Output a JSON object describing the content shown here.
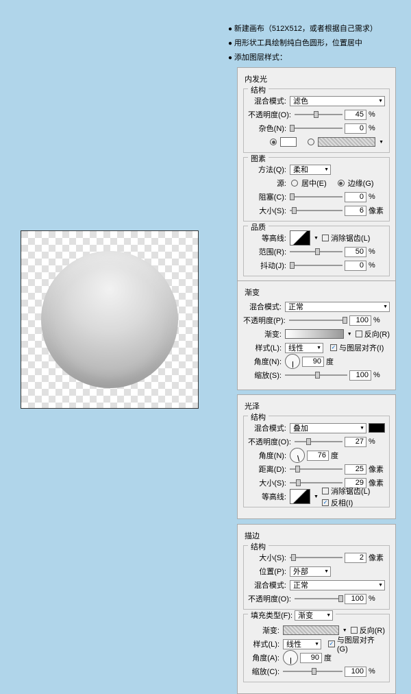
{
  "notes": {
    "l1": "新建画布（512X512，或者根据自己需求）",
    "l2": "用形状工具绘制纯白色圆形，位置居中",
    "l3": "添加图层样式："
  },
  "p1": {
    "title": "内发光",
    "g1": "结构",
    "g2": "图素",
    "g3": "品质",
    "blend_l": "混合模式:",
    "blend_v": "滤色",
    "opac_l": "不透明度(O):",
    "opac_v": "45",
    "pct": "%",
    "noise_l": "杂色(N):",
    "noise_v": "0",
    "method_l": "方法(Q):",
    "method_v": "柔和",
    "source_l": "源:",
    "src_c": "居中(E)",
    "src_e": "边缘(G)",
    "choke_l": "阻塞(C):",
    "choke_v": "0",
    "size_l": "大小(S):",
    "size_v": "6",
    "px": "像素",
    "contour_l": "等高线:",
    "aa": "消除锯齿(L)",
    "range_l": "范围(R):",
    "range_v": "50",
    "jit_l": "抖动(J):",
    "jit_v": "0"
  },
  "p2": {
    "title": "渐变",
    "blend_l": "混合模式:",
    "blend_v": "正常",
    "opac_l": "不透明度(P):",
    "opac_v": "100",
    "pct": "%",
    "grad_l": "渐变:",
    "rev": "反向(R)",
    "style_l": "样式(L):",
    "style_v": "线性",
    "align": "与图层对齐(I)",
    "ang_l": "角度(N):",
    "ang_v": "90",
    "deg": "度",
    "scale_l": "缩放(S):",
    "scale_v": "100"
  },
  "p3": {
    "title": "光泽",
    "g1": "结构",
    "blend_l": "混合模式:",
    "blend_v": "叠加",
    "opac_l": "不透明度(O):",
    "opac_v": "27",
    "pct": "%",
    "ang_l": "角度(N):",
    "ang_v": "76",
    "deg": "度",
    "dist_l": "距离(D):",
    "dist_v": "25",
    "px": "像素",
    "size_l": "大小(S):",
    "size_v": "29",
    "contour_l": "等高线:",
    "aa": "消除锯齿(L)",
    "inv": "反相(I)"
  },
  "p4": {
    "title": "描边",
    "g1": "结构",
    "g2": "填充类型(F):",
    "g2v": "渐变",
    "size_l": "大小(S):",
    "size_v": "2",
    "px": "像素",
    "pos_l": "位置(P):",
    "pos_v": "外部",
    "blend_l": "混合模式:",
    "blend_v": "正常",
    "opac_l": "不透明度(O):",
    "opac_v": "100",
    "pct": "%",
    "grad_l": "渐变:",
    "rev": "反向(R)",
    "style_l": "样式(L):",
    "style_v": "线性",
    "align": "与图层对齐(G)",
    "ang_l": "角度(A):",
    "ang_v": "90",
    "deg": "度",
    "scale_l": "缩放(C):",
    "scale_v": "100"
  }
}
